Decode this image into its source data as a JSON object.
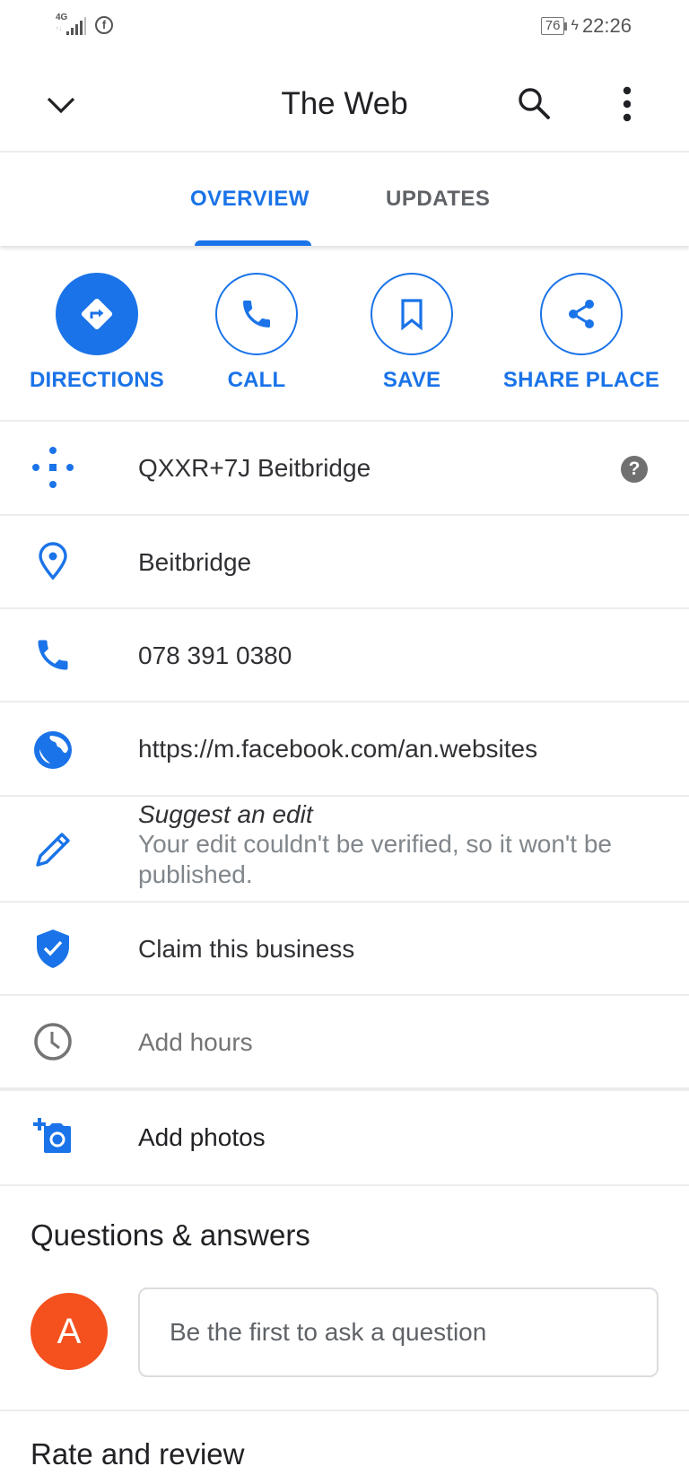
{
  "status_bar": {
    "network": "4G",
    "battery": "76",
    "time": "22:26"
  },
  "app_bar": {
    "title": "The Web",
    "back_icon": "chevron-down-icon",
    "search_icon": "search-icon",
    "more_icon": "more-vert-icon"
  },
  "tabs": [
    {
      "label": "OVERVIEW",
      "active": true
    },
    {
      "label": "UPDATES",
      "active": false
    }
  ],
  "actions": [
    {
      "label": "DIRECTIONS",
      "icon": "directions-icon"
    },
    {
      "label": "CALL",
      "icon": "phone-icon"
    },
    {
      "label": "SAVE",
      "icon": "bookmark-icon"
    },
    {
      "label": "SHARE PLACE",
      "icon": "share-icon"
    }
  ],
  "details": {
    "plus_code": "QXXR+7J Beitbridge",
    "address": "Beitbridge",
    "phone": "078 391 0380",
    "website": "https://m.facebook.com/an.websites",
    "suggest_edit_title": "Suggest an edit",
    "suggest_edit_sub": "Your edit couldn't be verified, so it won't be published.",
    "claim": "Claim this business",
    "hours": "Add hours",
    "photos": "Add photos"
  },
  "qa": {
    "title": "Questions & answers",
    "avatar_letter": "A",
    "placeholder": "Be the first to ask a question"
  },
  "rate_review": {
    "title": "Rate and review"
  },
  "colors": {
    "accent": "#1a73e8",
    "avatar": "#f4511e",
    "icon_gray": "#707070"
  }
}
